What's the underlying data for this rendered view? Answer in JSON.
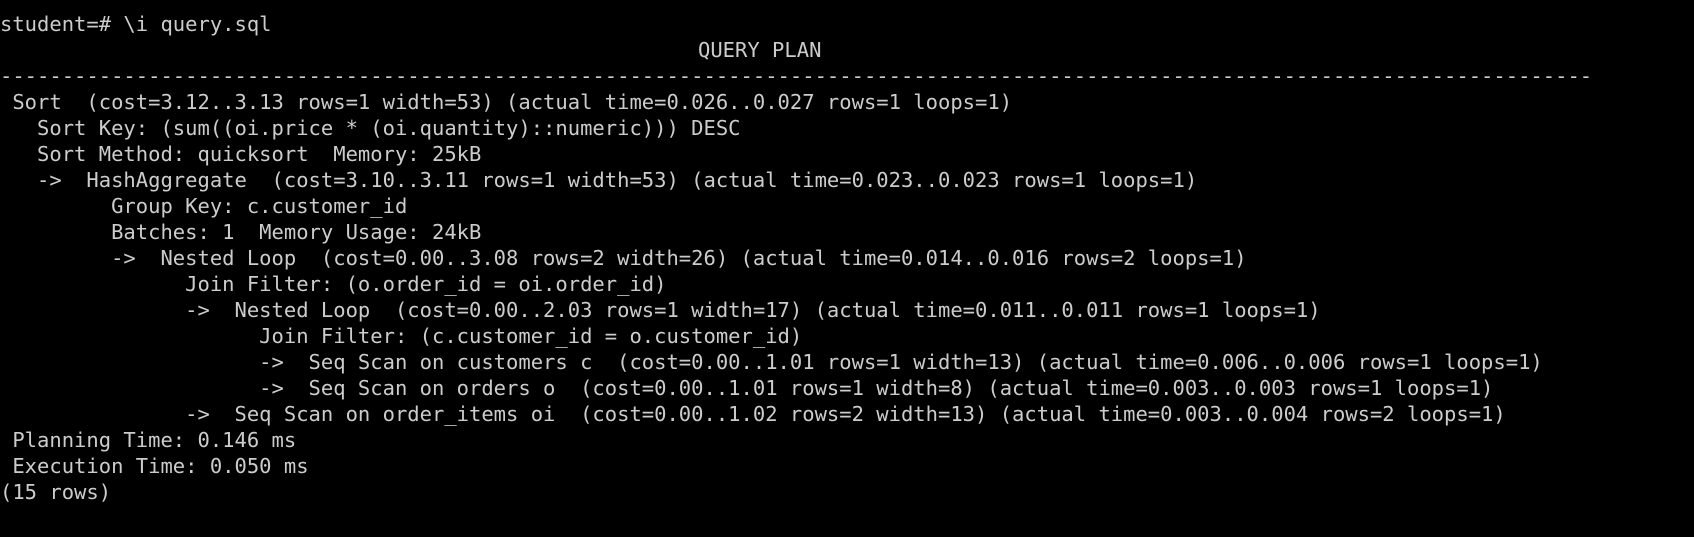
{
  "terminal": {
    "prompt_line": "student=# \\i query.sql",
    "header": "QUERY PLAN",
    "separator": "---------------------------------------------------------------------------------------------------------------------------------",
    "plan_rows": [
      " Sort  (cost=3.12..3.13 rows=1 width=53) (actual time=0.026..0.027 rows=1 loops=1)",
      "   Sort Key: (sum((oi.price * (oi.quantity)::numeric))) DESC",
      "   Sort Method: quicksort  Memory: 25kB",
      "   ->  HashAggregate  (cost=3.10..3.11 rows=1 width=53) (actual time=0.023..0.023 rows=1 loops=1)",
      "         Group Key: c.customer_id",
      "         Batches: 1  Memory Usage: 24kB",
      "         ->  Nested Loop  (cost=0.00..3.08 rows=2 width=26) (actual time=0.014..0.016 rows=2 loops=1)",
      "               Join Filter: (o.order_id = oi.order_id)",
      "               ->  Nested Loop  (cost=0.00..2.03 rows=1 width=17) (actual time=0.011..0.011 rows=1 loops=1)",
      "                     Join Filter: (c.customer_id = o.customer_id)",
      "                     ->  Seq Scan on customers c  (cost=0.00..1.01 rows=1 width=13) (actual time=0.006..0.006 rows=1 loops=1)",
      "                     ->  Seq Scan on orders o  (cost=0.00..1.01 rows=1 width=8) (actual time=0.003..0.003 rows=1 loops=1)",
      "               ->  Seq Scan on order_items oi  (cost=0.00..1.02 rows=2 width=13) (actual time=0.003..0.004 rows=2 loops=1)",
      " Planning Time: 0.146 ms",
      " Execution Time: 0.050 ms"
    ],
    "footer": "(15 rows)",
    "colors": {
      "background": "#000000",
      "text": "#cccccc"
    }
  }
}
